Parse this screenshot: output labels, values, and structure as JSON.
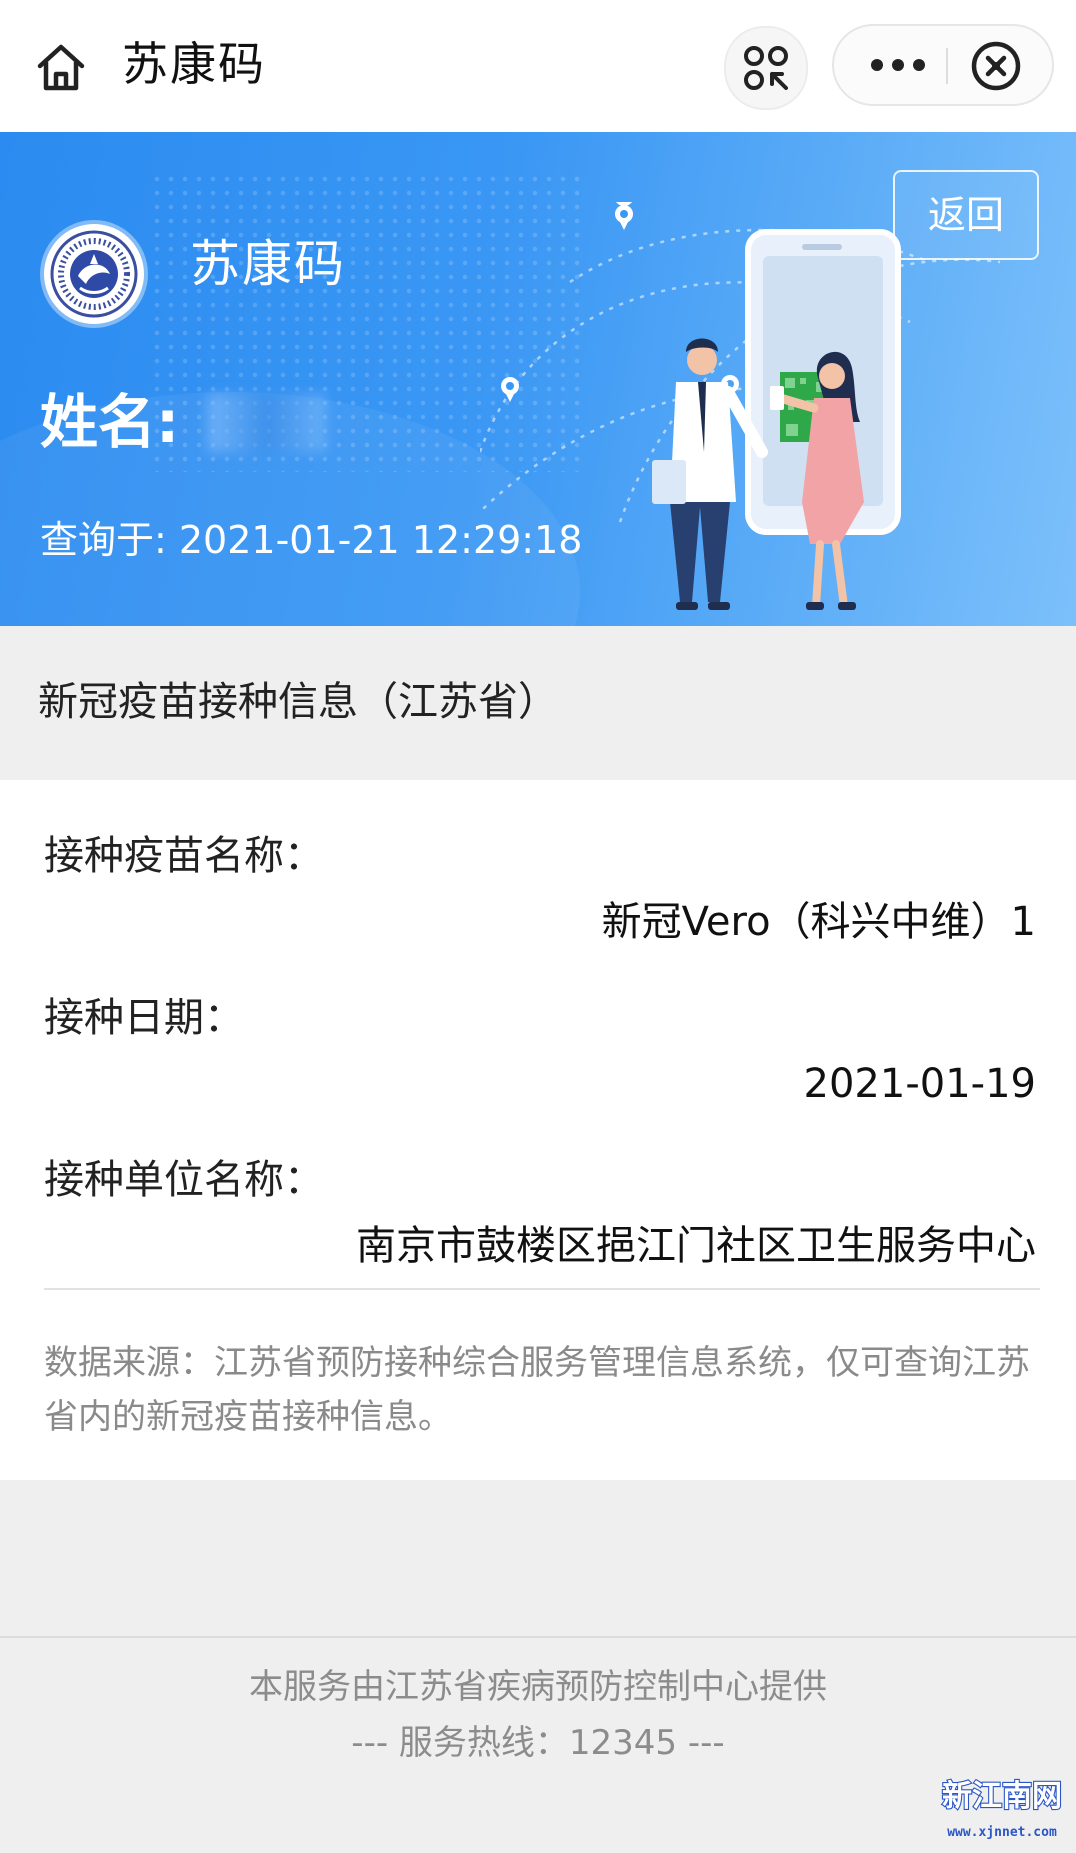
{
  "topbar": {
    "title": "苏康码",
    "icons": [
      "home-icon",
      "scan-icon",
      "more-icon",
      "close-icon"
    ]
  },
  "banner": {
    "logo_text": "苏康码",
    "name_label": "姓名:",
    "query_time": "查询于: 2021-01-21 12:29:18",
    "back_label": "返回",
    "colors": {
      "start": "#2b8bf0",
      "end": "#7cc0fb"
    }
  },
  "section": {
    "title": "新冠疫苗接种信息（江苏省）"
  },
  "fields": [
    {
      "label": "接种疫苗名称：",
      "value": "新冠Vero（科兴中维）1"
    },
    {
      "label": "接种日期：",
      "value": "2021-01-19"
    },
    {
      "label": "接种单位名称：",
      "value": "南京市鼓楼区挹江门社区卫生服务中心"
    }
  ],
  "note": "数据来源：江苏省预防接种综合服务管理信息系统，仅可查询江苏省内的新冠疫苗接种信息。",
  "footer": {
    "provider": "本服务由江苏省疾病预防控制中心提供",
    "hotline": "--- 服务热线：12345 ---"
  },
  "watermark": {
    "text": "新江南网",
    "url": "www.xjnnet.com"
  }
}
